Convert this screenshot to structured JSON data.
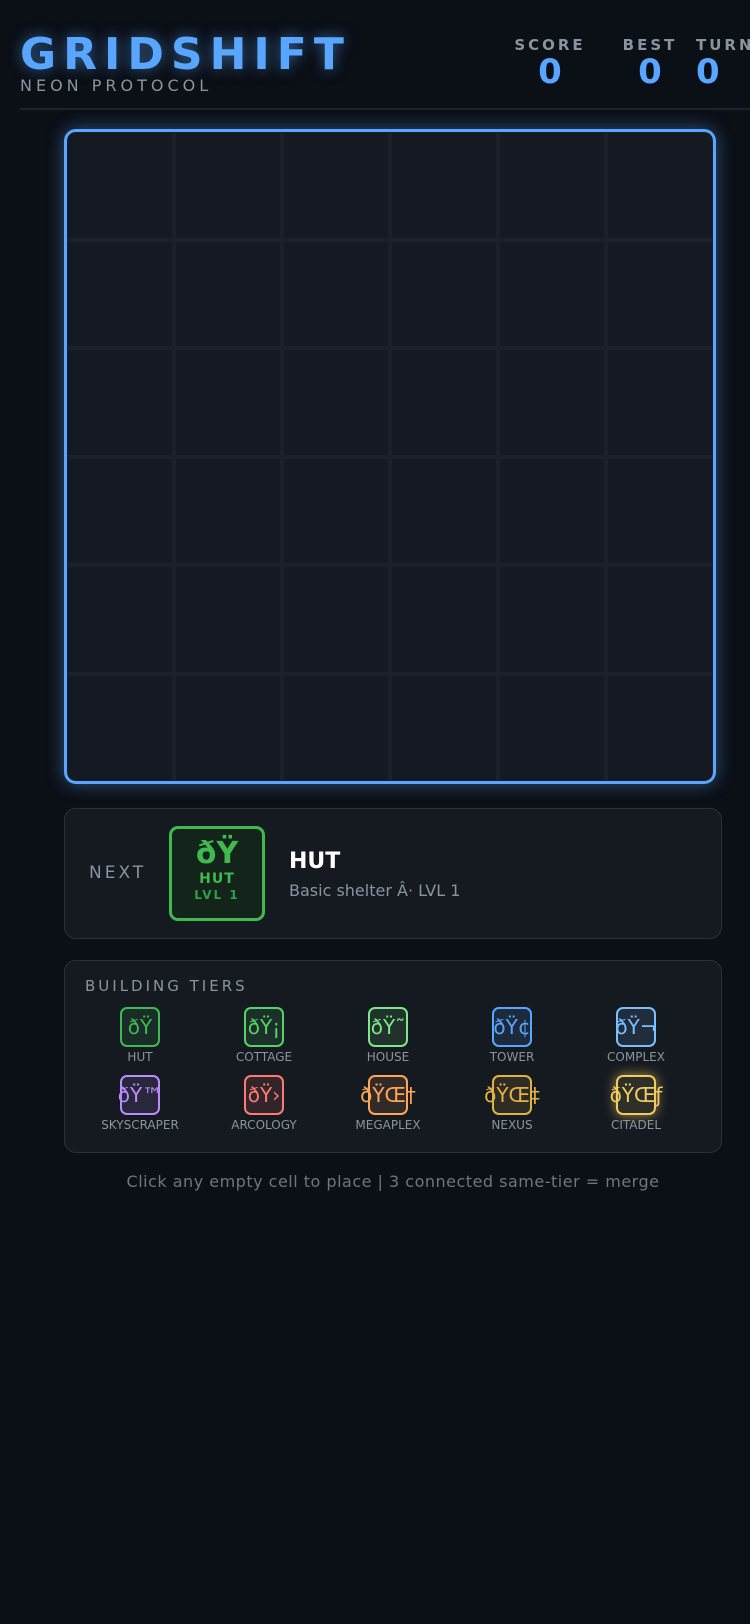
{
  "header": {
    "title": "GRIDSHIFT",
    "subtitle": "NEON PROTOCOL",
    "stats": {
      "score_label": "SCORE",
      "score_value": "0",
      "best_label": "BEST",
      "best_value": "0",
      "turn_label": "TURN",
      "turn_value": "0"
    }
  },
  "board": {
    "rows": 6,
    "cols": 6,
    "accent_color": "#58a6ff"
  },
  "next": {
    "label": "NEXT",
    "tile_icon": "ðŸ",
    "tile_name": "HUT",
    "tile_level": "LVL 1",
    "name": "HUT",
    "description": "Basic shelter Â· LVL 1",
    "color": "#3fb950"
  },
  "tiers": {
    "title": "BUILDING TIERS",
    "items": [
      {
        "name": "HUT",
        "icon": "ðŸ",
        "color": "#3fb950"
      },
      {
        "name": "COTTAGE",
        "icon": "ðŸ¡",
        "color": "#56d364"
      },
      {
        "name": "HOUSE",
        "icon": "ðŸ˜",
        "color": "#7ee787"
      },
      {
        "name": "TOWER",
        "icon": "ðŸ¢",
        "color": "#58a6ff"
      },
      {
        "name": "COMPLEX",
        "icon": "ðŸ¬",
        "color": "#79c0ff"
      },
      {
        "name": "SKYSCRAPER",
        "icon": "ðŸ™",
        "color": "#bc8cff"
      },
      {
        "name": "ARCOLOGY",
        "icon": "ðŸ›",
        "color": "#ff7b72"
      },
      {
        "name": "MEGAPLEX",
        "icon": "ðŸŒ†",
        "color": "#ffa657"
      },
      {
        "name": "NEXUS",
        "icon": "ðŸŒ‡",
        "color": "#e3b341"
      },
      {
        "name": "CITADEL",
        "icon": "ðŸŒƒ",
        "color": "#f2cc60"
      }
    ]
  },
  "footer": {
    "hint": "Click any empty cell to place  |  3 connected same-tier = merge"
  }
}
